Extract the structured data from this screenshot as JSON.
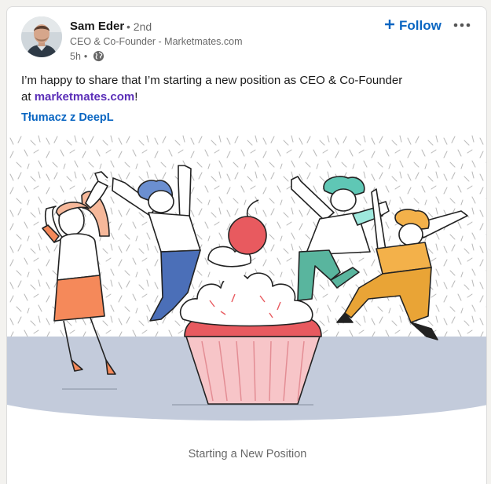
{
  "post": {
    "author": {
      "name": "Sam Eder",
      "degree": "• 2nd",
      "headline": "CEO & Co-Founder - Marketmates.com",
      "time": "5h",
      "visibility_separator": "•",
      "visibility_icon": "globe-icon"
    },
    "follow_label": "Follow",
    "more_icon": "more-horizontal-icon",
    "body_line1": "I’m happy to share that I’m starting a new position as CEO & Co-Founder",
    "body_prefix": "at ",
    "body_link": "marketmates.com",
    "body_suffix": "!",
    "translate_label": "Tłumacz z DeepL",
    "image_caption": "Starting a New Position"
  },
  "colors": {
    "link_blue": "#0a66c2",
    "mention_purple": "#5b2fb8",
    "floor": "#c3cbdb",
    "cherry": "#e85a5f",
    "cupcake_base": "#f7c5c8"
  }
}
